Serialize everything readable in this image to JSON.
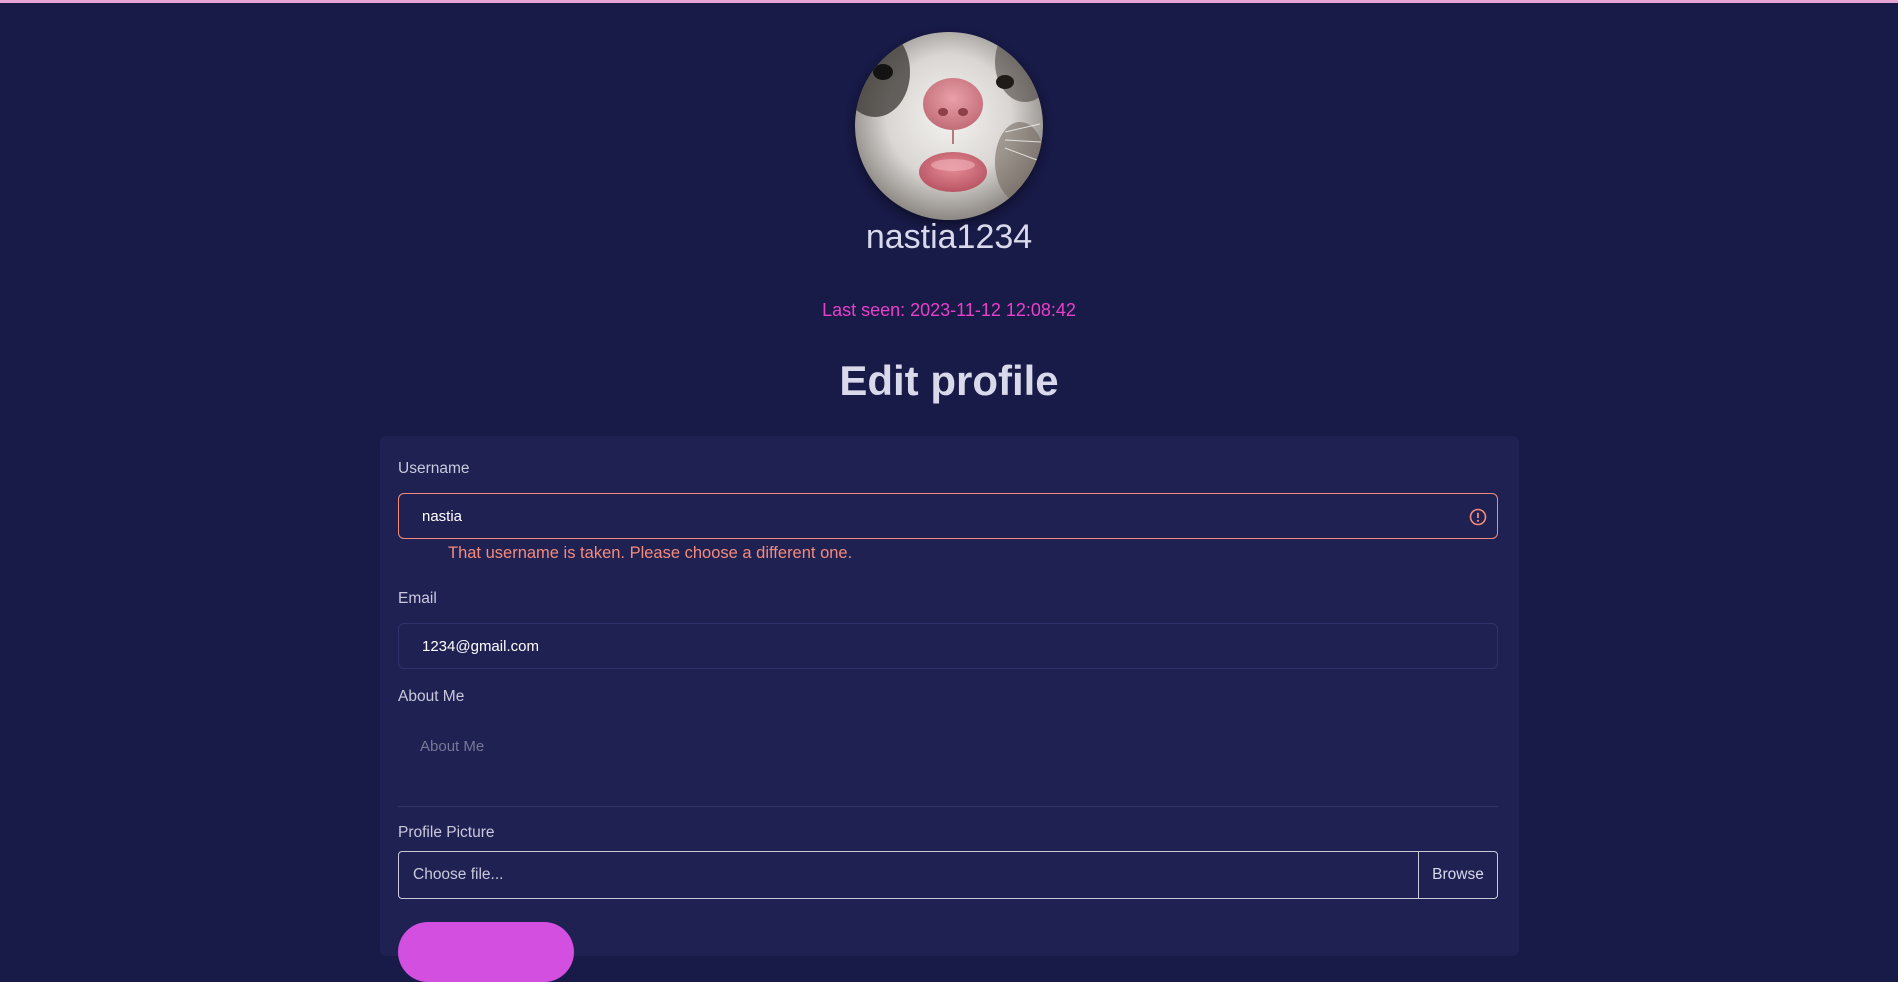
{
  "profile": {
    "username": "nastia1234",
    "last_seen": "Last seen: 2023-11-12 12:08:42"
  },
  "form": {
    "title": "Edit profile",
    "username_label": "Username",
    "username_value": "nastia",
    "username_error": "That username is taken. Please choose a different one.",
    "email_label": "Email",
    "email_value": "1234@gmail.com",
    "about_label": "About Me",
    "about_placeholder": "About Me",
    "picture_label": "Profile Picture",
    "file_placeholder": "Choose file...",
    "browse_label": "Browse"
  },
  "colors": {
    "background": "#181a47",
    "card": "#202153",
    "accent": "#e840c9",
    "error": "#f48b7a",
    "button": "#d24fe0"
  }
}
